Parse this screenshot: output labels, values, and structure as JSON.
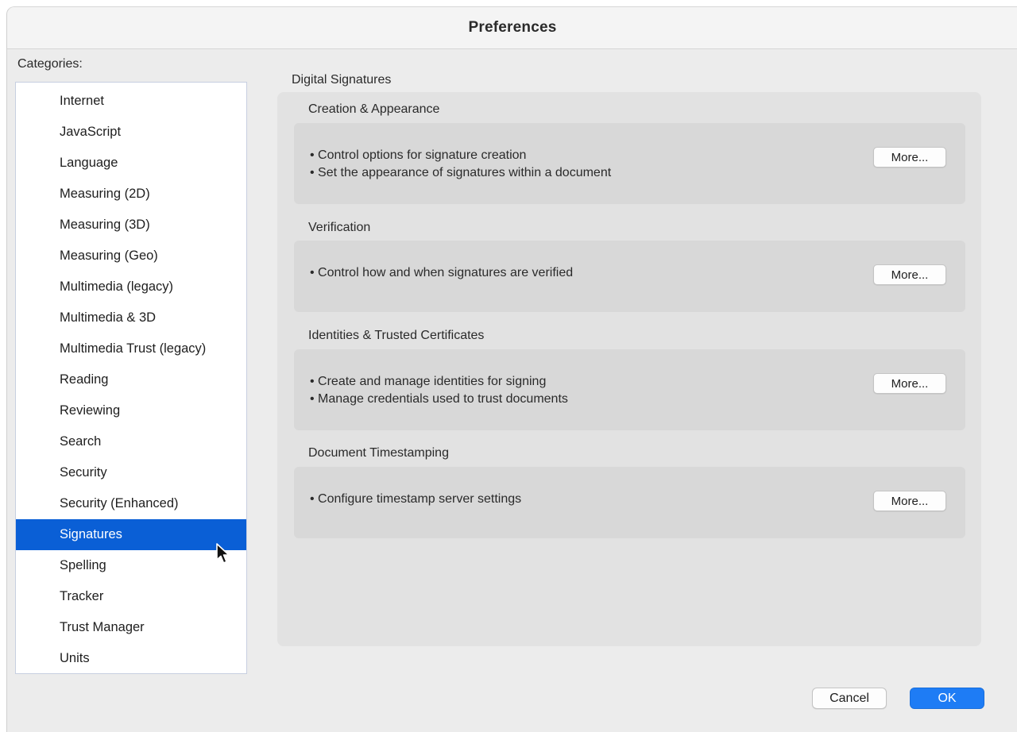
{
  "window": {
    "title": "Preferences"
  },
  "sidebar": {
    "label": "Categories:",
    "items": [
      {
        "label": "Internet"
      },
      {
        "label": "JavaScript"
      },
      {
        "label": "Language"
      },
      {
        "label": "Measuring (2D)"
      },
      {
        "label": "Measuring (3D)"
      },
      {
        "label": "Measuring (Geo)"
      },
      {
        "label": "Multimedia (legacy)"
      },
      {
        "label": "Multimedia & 3D"
      },
      {
        "label": "Multimedia Trust (legacy)"
      },
      {
        "label": "Reading"
      },
      {
        "label": "Reviewing"
      },
      {
        "label": "Search"
      },
      {
        "label": "Security"
      },
      {
        "label": "Security (Enhanced)"
      },
      {
        "label": "Signatures"
      },
      {
        "label": "Spelling"
      },
      {
        "label": "Tracker"
      },
      {
        "label": "Trust Manager"
      },
      {
        "label": "Units"
      }
    ],
    "selected": "Signatures"
  },
  "main": {
    "section_title": "Digital Signatures",
    "groups": [
      {
        "title": "Creation & Appearance",
        "lines": [
          "• Control options for signature creation",
          "• Set the appearance of signatures within a document"
        ],
        "button": "More..."
      },
      {
        "title": "Verification",
        "lines": [
          "• Control how and when signatures are verified"
        ],
        "button": "More..."
      },
      {
        "title": "Identities & Trusted Certificates",
        "lines": [
          "• Create and manage identities for signing",
          "• Manage credentials used to trust documents"
        ],
        "button": "More..."
      },
      {
        "title": "Document Timestamping",
        "lines": [
          "• Configure timestamp server settings"
        ],
        "button": "More..."
      }
    ]
  },
  "footer": {
    "cancel_label": "Cancel",
    "ok_label": "OK"
  },
  "colors": {
    "selection": "#0a5fd6",
    "primary_button": "#1e7cf5",
    "window_bg": "#ececec"
  },
  "icons": {
    "pointer": "mouse-pointer-icon"
  }
}
